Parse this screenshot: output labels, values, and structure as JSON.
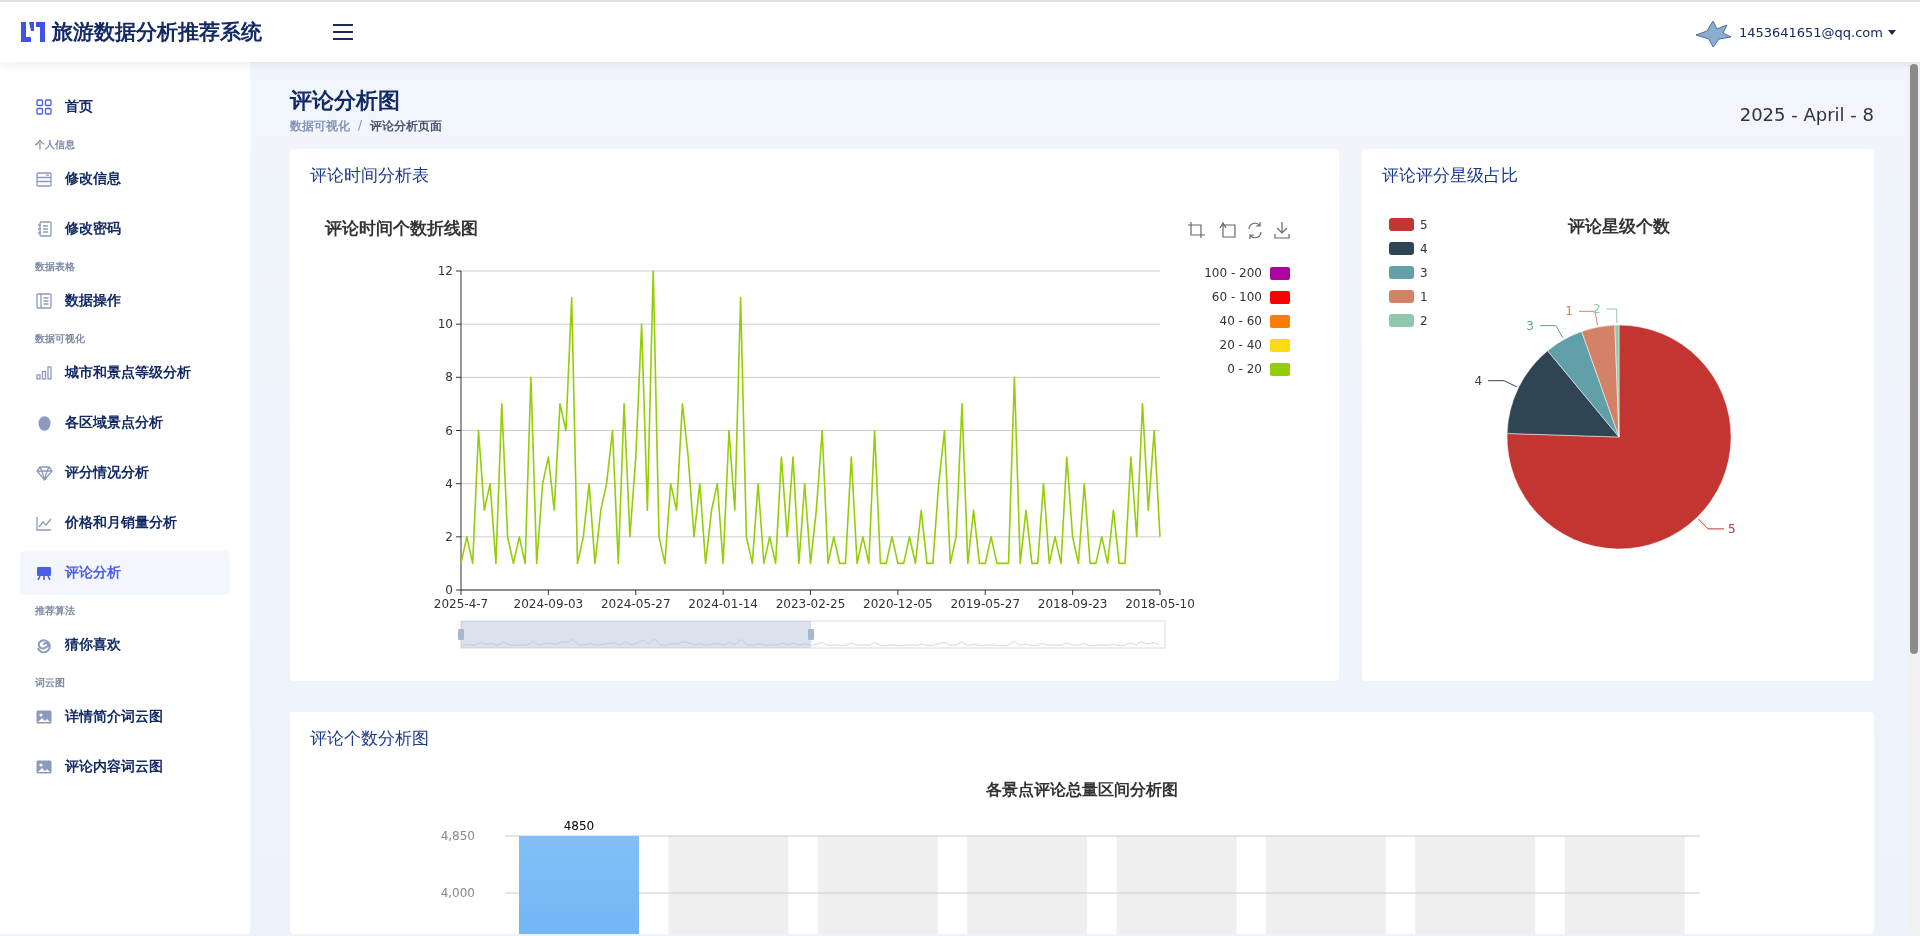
{
  "header": {
    "title": "旅游数据分析推荐系统",
    "user": "1453641651@qq.com"
  },
  "sidebar": {
    "items": [
      {
        "kind": "link",
        "label": "首页",
        "selected": false
      },
      {
        "kind": "heading",
        "label": "个人信息"
      },
      {
        "kind": "link",
        "label": "修改信息",
        "selected": false
      },
      {
        "kind": "link",
        "label": "修改密码",
        "selected": false
      },
      {
        "kind": "heading",
        "label": "数据表格"
      },
      {
        "kind": "link",
        "label": "数据操作",
        "selected": false
      },
      {
        "kind": "heading",
        "label": "数据可视化"
      },
      {
        "kind": "link",
        "label": "城市和景点等级分析",
        "selected": false
      },
      {
        "kind": "link",
        "label": "各区域景点分析",
        "selected": false
      },
      {
        "kind": "link",
        "label": "评分情况分析",
        "selected": false
      },
      {
        "kind": "link",
        "label": "价格和月销量分析",
        "selected": false
      },
      {
        "kind": "link",
        "label": "评论分析",
        "selected": true
      },
      {
        "kind": "heading",
        "label": "推荐算法"
      },
      {
        "kind": "link",
        "label": "猜你喜欢",
        "selected": false
      },
      {
        "kind": "heading",
        "label": "词云图"
      },
      {
        "kind": "link",
        "label": "详情简介词云图",
        "selected": false
      },
      {
        "kind": "link",
        "label": "评论内容词云图",
        "selected": false
      }
    ]
  },
  "page": {
    "title": "评论分析图",
    "breadcrumb": [
      "数据可视化",
      "/",
      "评论分析页面"
    ],
    "date": "2025 - April - 8"
  },
  "time_card": {
    "heading": "评论时间分析表",
    "visual_map": [
      {
        "label": "100 - 200",
        "color": "#aa069f"
      },
      {
        "label": "60 - 100",
        "color": "#fd0100"
      },
      {
        "label": "40 - 60",
        "color": "#fc7d02"
      },
      {
        "label": "20 - 40",
        "color": "#fbdb0f"
      },
      {
        "label": "0 - 20",
        "color": "#93ce07"
      }
    ],
    "chart_data": {
      "type": "line",
      "title": "评论时间个数折线图",
      "ylim": [
        0,
        12
      ],
      "yticks": [
        0,
        2,
        4,
        6,
        8,
        10,
        12
      ],
      "grid": true,
      "categories": [
        "2025-4-7",
        null,
        null,
        null,
        null,
        null,
        null,
        null,
        null,
        null,
        null,
        null,
        null,
        null,
        null,
        "2024-09-03",
        null,
        null,
        null,
        null,
        null,
        null,
        null,
        null,
        null,
        null,
        null,
        null,
        null,
        null,
        "2024-05-27",
        null,
        null,
        null,
        null,
        null,
        null,
        null,
        null,
        null,
        null,
        null,
        null,
        null,
        null,
        "2024-01-14",
        null,
        null,
        null,
        null,
        null,
        null,
        null,
        null,
        null,
        null,
        null,
        null,
        null,
        null,
        "2023-02-25",
        null,
        null,
        null,
        null,
        null,
        null,
        null,
        null,
        null,
        null,
        null,
        null,
        null,
        null,
        "2020-12-05",
        null,
        null,
        null,
        null,
        null,
        null,
        null,
        null,
        null,
        null,
        null,
        null,
        null,
        null,
        "2019-05-27",
        null,
        null,
        null,
        null,
        null,
        null,
        null,
        null,
        null,
        null,
        null,
        null,
        null,
        null,
        "2018-09-23",
        null,
        null,
        null,
        null,
        null,
        null,
        null,
        null,
        null,
        null,
        null,
        null,
        null,
        null,
        "2018-05-10"
      ],
      "series": [
        {
          "color": "#93ce07",
          "values": [
            1,
            2,
            1,
            6,
            3,
            4,
            1,
            7,
            2,
            1,
            2,
            1,
            8,
            1,
            4,
            5,
            3,
            7,
            6,
            11,
            1,
            2,
            4,
            1,
            3,
            4,
            6,
            1,
            7,
            2,
            5,
            10,
            3,
            12,
            2,
            1,
            4,
            3,
            7,
            5,
            2,
            4,
            1,
            3,
            4,
            1,
            6,
            3,
            11,
            2,
            1,
            4,
            1,
            2,
            1,
            5,
            2,
            5,
            1,
            4,
            1,
            3,
            6,
            1,
            2,
            1,
            1,
            5,
            1,
            2,
            1,
            6,
            1,
            1,
            2,
            1,
            1,
            2,
            1,
            3,
            1,
            1,
            4,
            6,
            1,
            2,
            7,
            1,
            3,
            1,
            1,
            2,
            1,
            1,
            1,
            8,
            1,
            3,
            1,
            1,
            4,
            1,
            2,
            1,
            5,
            2,
            1,
            4,
            1,
            1,
            2,
            1,
            3,
            1,
            1,
            5,
            2,
            7,
            3,
            6,
            2
          ]
        }
      ]
    }
  },
  "star_card": {
    "heading": "评论评分星级占比",
    "chart_data": {
      "type": "pie",
      "title": "评论星级个数",
      "categories": [
        "5",
        "4",
        "3",
        "1",
        "2"
      ],
      "legend": "left",
      "series": [
        {
          "values": [
            75.5,
            13.5,
            5.6,
            4.8,
            0.6
          ]
        }
      ],
      "colors": [
        "#c23531",
        "#2f4554",
        "#61a0a8",
        "#d48265",
        "#91c7ae"
      ]
    },
    "slice_labels": [
      "5",
      "4",
      "3",
      "1",
      "2"
    ]
  },
  "count_card": {
    "heading": "评论个数分析图",
    "chart_data": {
      "type": "bar",
      "title": "各景点评论总量区间分析图",
      "grid": true,
      "ylim": [
        0,
        4850
      ],
      "yticks": [
        {
          "value": 4000,
          "label": "4,000"
        },
        {
          "value": 4850,
          "label": "4,850"
        }
      ],
      "stacked": true,
      "series": [
        {
          "color": "#4aa3f5",
          "values": [
            4850,
            null,
            null,
            null,
            null,
            null,
            null,
            null
          ]
        },
        {
          "color": "#efefef",
          "values": [
            0,
            4850,
            4850,
            4850,
            4850,
            4850,
            4850,
            4850
          ]
        }
      ],
      "value_labels": [
        "4850"
      ]
    }
  }
}
